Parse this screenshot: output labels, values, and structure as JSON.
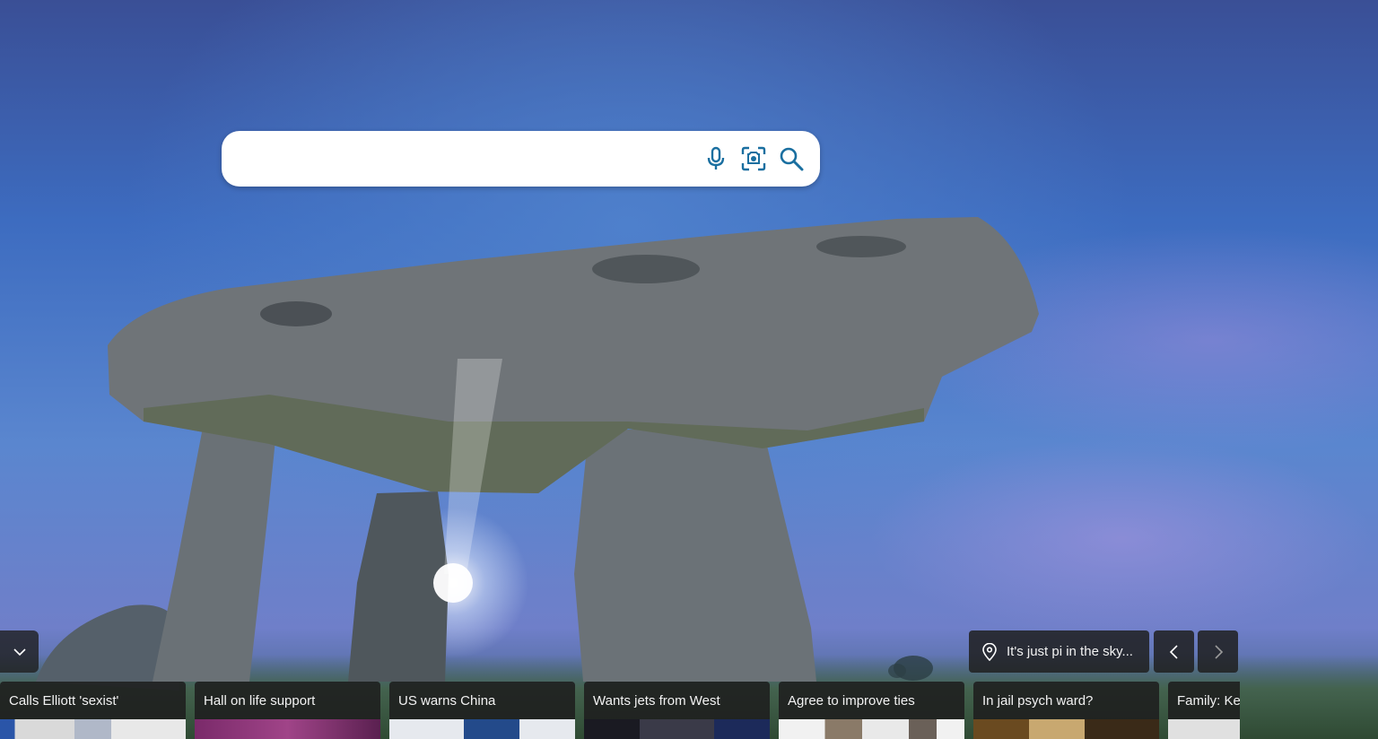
{
  "search": {
    "value": "",
    "placeholder": "",
    "icons": [
      "microphone-icon",
      "visual-search-icon",
      "search-icon"
    ]
  },
  "image_info": {
    "caption": "It's just pi in the sky...",
    "icon": "location-pin-icon"
  },
  "controls": {
    "collapse_icon": "chevron-down-icon",
    "prev_icon": "chevron-left-icon",
    "next_icon": "chevron-right-icon"
  },
  "news": [
    {
      "title": "Calls Elliott 'sexist'"
    },
    {
      "title": "Hall on life support"
    },
    {
      "title": "US warns China"
    },
    {
      "title": "Wants jets from West"
    },
    {
      "title": "Agree to improve ties"
    },
    {
      "title": "In jail psych ward?"
    },
    {
      "title": "Family: Ke"
    }
  ],
  "colors": {
    "search_icon": "#1a6fa0",
    "panel_bg": "#1e1e1e",
    "panel_text": "#f2f2f2"
  }
}
